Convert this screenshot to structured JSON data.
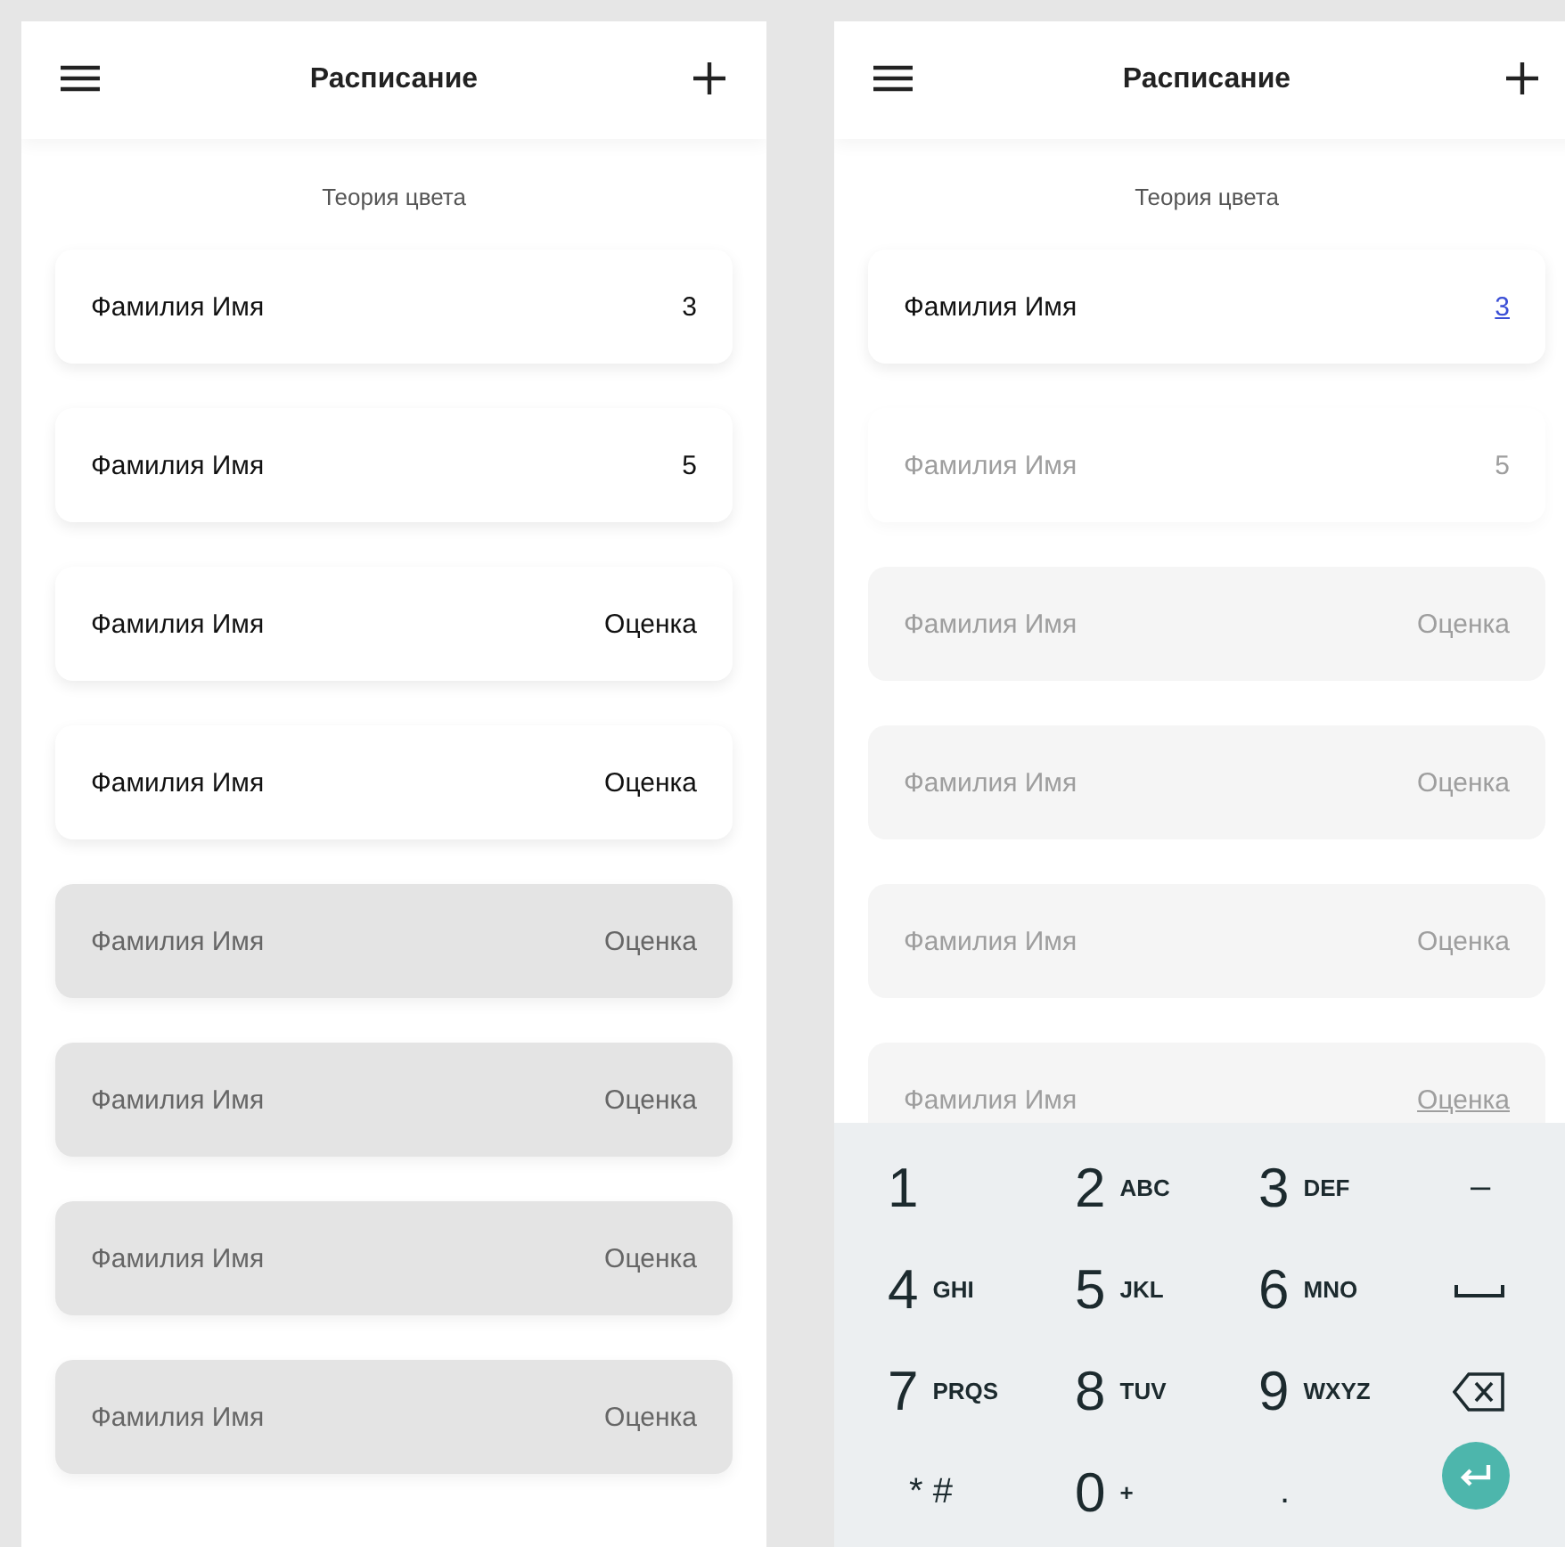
{
  "screens": [
    {
      "header": {
        "title": "Расписание"
      },
      "subject": "Теория цвета",
      "rows": [
        {
          "name": "Фамилия Имя",
          "grade": "3",
          "filled": true,
          "dimmed": false,
          "editing": false,
          "underlined": false
        },
        {
          "name": "Фамилия Имя",
          "grade": "5",
          "filled": true,
          "dimmed": false,
          "editing": false,
          "underlined": false
        },
        {
          "name": "Фамилия Имя",
          "grade": "Оценка",
          "filled": true,
          "dimmed": false,
          "editing": false,
          "underlined": false
        },
        {
          "name": "Фамилия Имя",
          "grade": "Оценка",
          "filled": true,
          "dimmed": false,
          "editing": false,
          "underlined": false
        },
        {
          "name": "Фамилия Имя",
          "grade": "Оценка",
          "filled": false,
          "dimmed": false,
          "editing": false,
          "underlined": false
        },
        {
          "name": "Фамилия Имя",
          "grade": "Оценка",
          "filled": false,
          "dimmed": false,
          "editing": false,
          "underlined": false
        },
        {
          "name": "Фамилия Имя",
          "grade": "Оценка",
          "filled": false,
          "dimmed": false,
          "editing": false,
          "underlined": false
        },
        {
          "name": "Фамилия Имя",
          "grade": "Оценка",
          "filled": false,
          "dimmed": false,
          "editing": false,
          "underlined": false
        }
      ]
    },
    {
      "header": {
        "title": "Расписание"
      },
      "subject": "Теория цвета",
      "rows": [
        {
          "name": "Фамилия Имя",
          "grade": "3",
          "filled": true,
          "dimmed": false,
          "editing": true,
          "underlined": false
        },
        {
          "name": "Фамилия Имя",
          "grade": "5",
          "filled": true,
          "dimmed": true,
          "editing": false,
          "underlined": false
        },
        {
          "name": "Фамилия Имя",
          "grade": "Оценка",
          "filled": false,
          "dimmed": true,
          "editing": false,
          "underlined": false
        },
        {
          "name": "Фамилия Имя",
          "grade": "Оценка",
          "filled": false,
          "dimmed": true,
          "editing": false,
          "underlined": false
        },
        {
          "name": "Фамилия Имя",
          "grade": "Оценка",
          "filled": false,
          "dimmed": true,
          "editing": false,
          "underlined": false
        },
        {
          "name": "Фамилия Имя",
          "grade": "Оценка",
          "filled": false,
          "dimmed": true,
          "editing": false,
          "underlined": true
        }
      ],
      "keyboard": {
        "keys": [
          {
            "kind": "digit",
            "main": "1"
          },
          {
            "kind": "digit",
            "main": "2",
            "sub": "ABC"
          },
          {
            "kind": "digit",
            "main": "3",
            "sub": "DEF"
          },
          {
            "kind": "symbol",
            "main": "–"
          },
          {
            "kind": "digit",
            "main": "4",
            "sub": "GHI"
          },
          {
            "kind": "digit",
            "main": "5",
            "sub": "JKL"
          },
          {
            "kind": "digit",
            "main": "6",
            "sub": "MNO"
          },
          {
            "kind": "space"
          },
          {
            "kind": "digit",
            "main": "7",
            "sub": "PRQS"
          },
          {
            "kind": "digit",
            "main": "8",
            "sub": "TUV"
          },
          {
            "kind": "digit",
            "main": "9",
            "sub": "WXYZ"
          },
          {
            "kind": "backspace"
          },
          {
            "kind": "symbol",
            "main": "* #"
          },
          {
            "kind": "digit",
            "main": "0",
            "sub": "+"
          },
          {
            "kind": "symbol",
            "main": "."
          },
          {
            "kind": "enter"
          }
        ]
      }
    }
  ]
}
